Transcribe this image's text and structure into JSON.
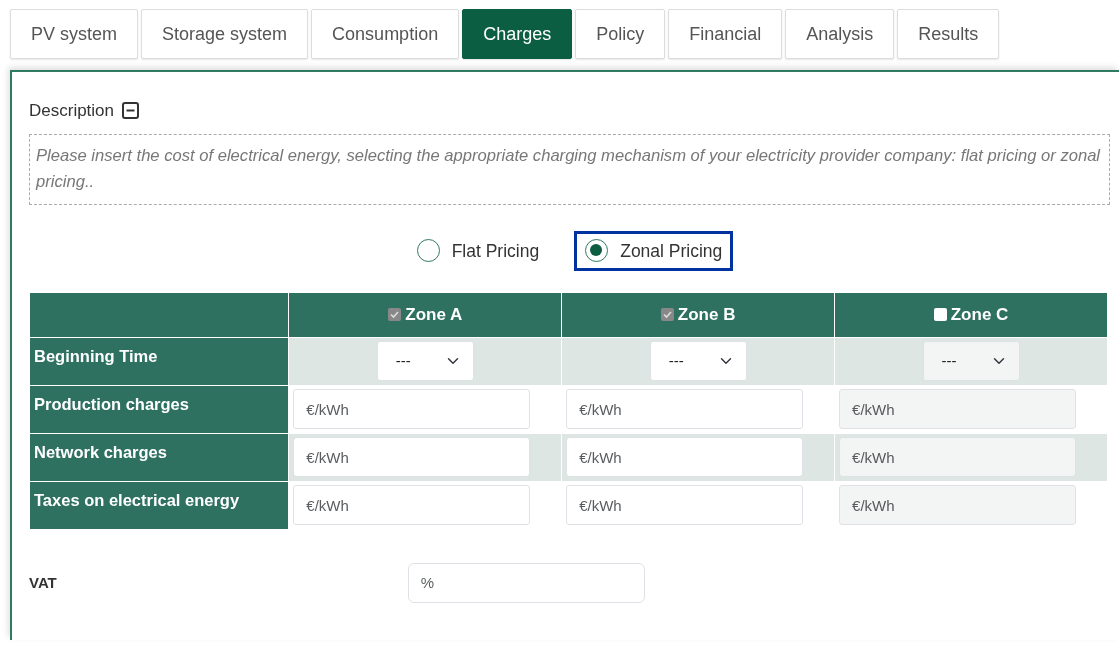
{
  "tabs": [
    {
      "label": "PV system",
      "selected": false
    },
    {
      "label": "Storage system",
      "selected": false
    },
    {
      "label": "Consumption",
      "selected": false
    },
    {
      "label": "Charges",
      "selected": true
    },
    {
      "label": "Policy",
      "selected": false
    },
    {
      "label": "Financial",
      "selected": false
    },
    {
      "label": "Analysis",
      "selected": false
    },
    {
      "label": "Results",
      "selected": false
    }
  ],
  "description": {
    "title": "Description",
    "expanded": true,
    "text": "Please insert the cost of electrical energy, selecting the appropriate charging mechanism of your electricity provider company: flat pricing or zonal pricing.."
  },
  "pricing_options": [
    {
      "label": "Flat Pricing",
      "selected": false,
      "focused": false
    },
    {
      "label": "Zonal Pricing",
      "selected": true,
      "focused": true
    }
  ],
  "zones": [
    {
      "label": "Zone A",
      "checked": true
    },
    {
      "label": "Zone B",
      "checked": true
    },
    {
      "label": "Zone C",
      "checked": false
    }
  ],
  "rows": [
    {
      "label": "Beginning Time",
      "kind": "select",
      "cells": [
        {
          "value": "---"
        },
        {
          "value": "---"
        },
        {
          "value": "---"
        }
      ]
    },
    {
      "label": "Production charges",
      "kind": "input",
      "cells": [
        {
          "placeholder": "€/kWh"
        },
        {
          "placeholder": "€/kWh"
        },
        {
          "placeholder": "€/kWh"
        }
      ]
    },
    {
      "label": "Network charges",
      "kind": "input",
      "cells": [
        {
          "placeholder": "€/kWh"
        },
        {
          "placeholder": "€/kWh"
        },
        {
          "placeholder": "€/kWh"
        }
      ]
    },
    {
      "label": "Taxes on electrical energy",
      "kind": "input",
      "cells": [
        {
          "placeholder": "€/kWh"
        },
        {
          "placeholder": "€/kWh"
        },
        {
          "placeholder": "€/kWh"
        }
      ]
    }
  ],
  "vat": {
    "label": "VAT",
    "placeholder": "%"
  }
}
